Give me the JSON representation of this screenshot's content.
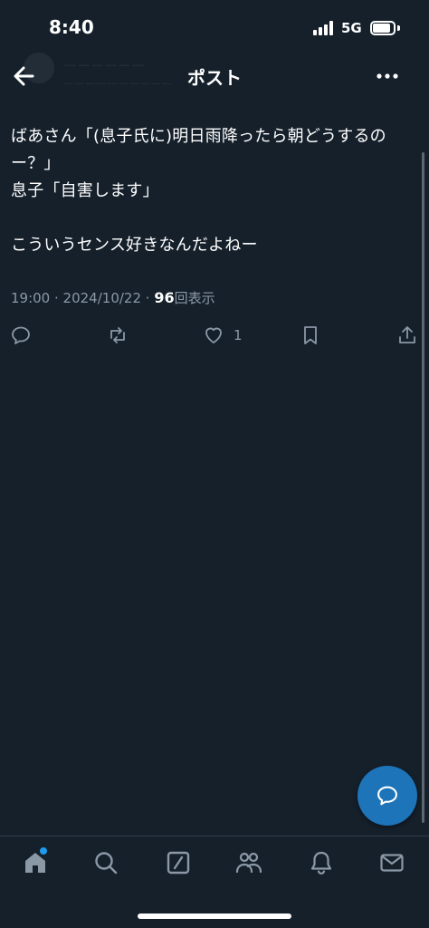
{
  "status_bar": {
    "time": "8:40",
    "network": "5G",
    "icons": [
      "signal-icon",
      "battery-icon"
    ]
  },
  "header": {
    "title": "ポスト",
    "back_icon": "arrow-left-icon",
    "more_icon": "more-horizontal-icon"
  },
  "post": {
    "text": "ばあさん「(息子氏に)明日雨降ったら朝どうするの\nー？」\n息子「自害します」\n\nこういうセンス好きなんだよねー",
    "time": "19:00",
    "date": "2024/10/22",
    "views_count": "96",
    "views_label": "回表示",
    "separator": " · "
  },
  "actions": {
    "reply_icon": "reply-icon",
    "repost_icon": "repost-icon",
    "like_icon": "heart-icon",
    "like_count": "1",
    "bookmark_icon": "bookmark-icon",
    "share_icon": "share-icon"
  },
  "fab": {
    "icon": "reply-plus-icon"
  },
  "bottom_nav": {
    "items": [
      "home-icon",
      "search-icon",
      "grok-icon",
      "communities-icon",
      "notifications-icon",
      "messages-icon"
    ]
  },
  "colors": {
    "background": "#15202b",
    "text": "#ffffff",
    "secondary_text": "#8b98a5",
    "accent": "#1d9bf0",
    "fab": "#1d74b8"
  }
}
